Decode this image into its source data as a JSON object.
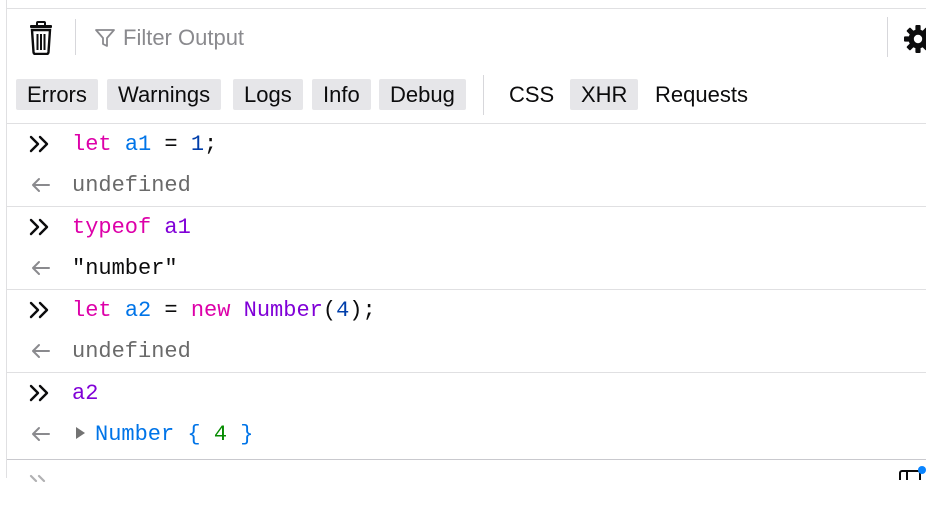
{
  "toolbar": {
    "trash_icon": "trash-icon",
    "filter_icon": "filter-icon",
    "filter_placeholder": "Filter Output",
    "settings_icon": "gear-icon"
  },
  "filters": {
    "levels": [
      {
        "label": "Errors",
        "active": true
      },
      {
        "label": "Warnings",
        "active": true
      },
      {
        "label": "Logs",
        "active": true
      },
      {
        "label": "Info",
        "active": true
      },
      {
        "label": "Debug",
        "active": true
      }
    ],
    "types": [
      {
        "label": "CSS",
        "active": false
      },
      {
        "label": "XHR",
        "active": true
      },
      {
        "label": "Requests",
        "active": false
      }
    ]
  },
  "console": {
    "entries": [
      {
        "input": [
          "let",
          "a1",
          "=",
          "1",
          ";"
        ],
        "output": "undefined"
      },
      {
        "input": [
          "typeof",
          "a1"
        ],
        "output": "\"number\""
      },
      {
        "input": [
          "let",
          "a2",
          "=",
          "new",
          "Number",
          "(",
          "4",
          ");"
        ],
        "output": "undefined"
      },
      {
        "input": [
          "a2"
        ],
        "output": [
          "Number",
          "{",
          "4",
          "}"
        ]
      }
    ]
  },
  "colors": {
    "keyword": "#dd00a9",
    "variable": "#0074e8",
    "number": "#003eaa",
    "function": "#8000d7",
    "object_number": "#058b00",
    "muted": "#6a6a6a"
  }
}
